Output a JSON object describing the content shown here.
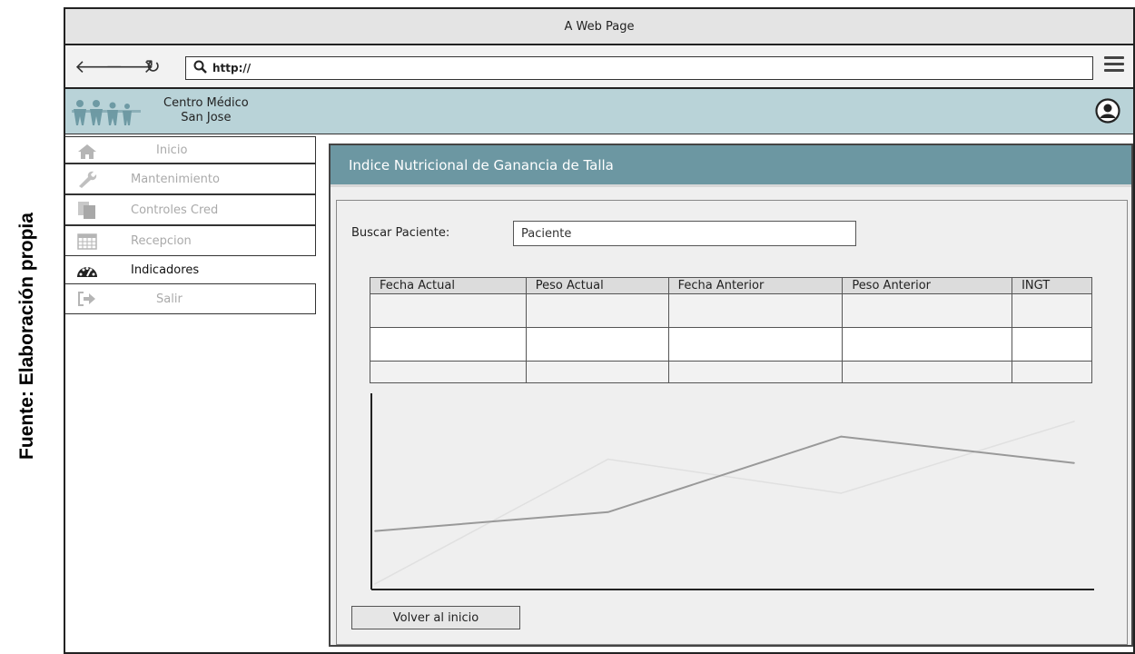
{
  "caption": "Fuente: Elaboración propia",
  "browser": {
    "title": "A Web Page",
    "url": "http://"
  },
  "app": {
    "brand_line1": "Centro Médico",
    "brand_line2": "San Jose"
  },
  "sidebar": {
    "items": [
      {
        "label": "Inicio",
        "icon": "home-icon"
      },
      {
        "label": "Mantenimiento",
        "icon": "wrench-icon"
      },
      {
        "label": "Controles Cred",
        "icon": "documents-icon"
      },
      {
        "label": "Recepcion",
        "icon": "calendar-icon"
      },
      {
        "label": "Indicadores",
        "icon": "gauge-icon",
        "active": true
      },
      {
        "label": "Salir",
        "icon": "exit-icon"
      }
    ]
  },
  "panel": {
    "title": "Indice Nutricional de Ganancia de Talla",
    "search_label": "Buscar Paciente:",
    "search_value": "Paciente",
    "back_button": "Volver al inicio"
  },
  "table": {
    "columns": [
      "Fecha Actual",
      "Peso Actual",
      "Fecha Anterior",
      "Peso Anterior",
      "INGT"
    ],
    "rows": [
      [
        "",
        "",
        "",
        "",
        ""
      ],
      [
        "",
        "",
        "",
        "",
        ""
      ],
      [
        "",
        "",
        "",
        "",
        ""
      ]
    ]
  },
  "chart_data": {
    "type": "line",
    "x": [
      0,
      1,
      2,
      3
    ],
    "series": [
      {
        "values": [
          30,
          40,
          80,
          66
        ],
        "color": "#999999"
      },
      {
        "values": [
          2,
          68,
          50,
          88
        ],
        "color": "#e0e0e0"
      }
    ],
    "ylim": [
      0,
      100
    ],
    "grid": false
  },
  "colors": {
    "header_bg": "#b9d3d8",
    "panel_title_bg": "#6c97a2",
    "sidebar_muted": "#aaaaaa"
  }
}
